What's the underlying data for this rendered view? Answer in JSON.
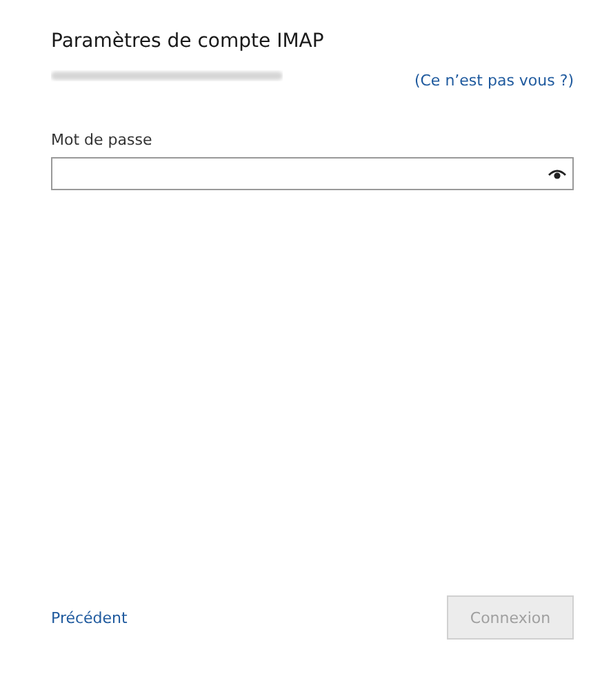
{
  "title": "Paramètres de compte IMAP",
  "account": {
    "not_you_link": "(Ce n’est pas vous ?)"
  },
  "password": {
    "label": "Mot de passe"
  },
  "back_link": "Précédent",
  "connect_button": {
    "label": "Connexion",
    "disabled": true
  }
}
